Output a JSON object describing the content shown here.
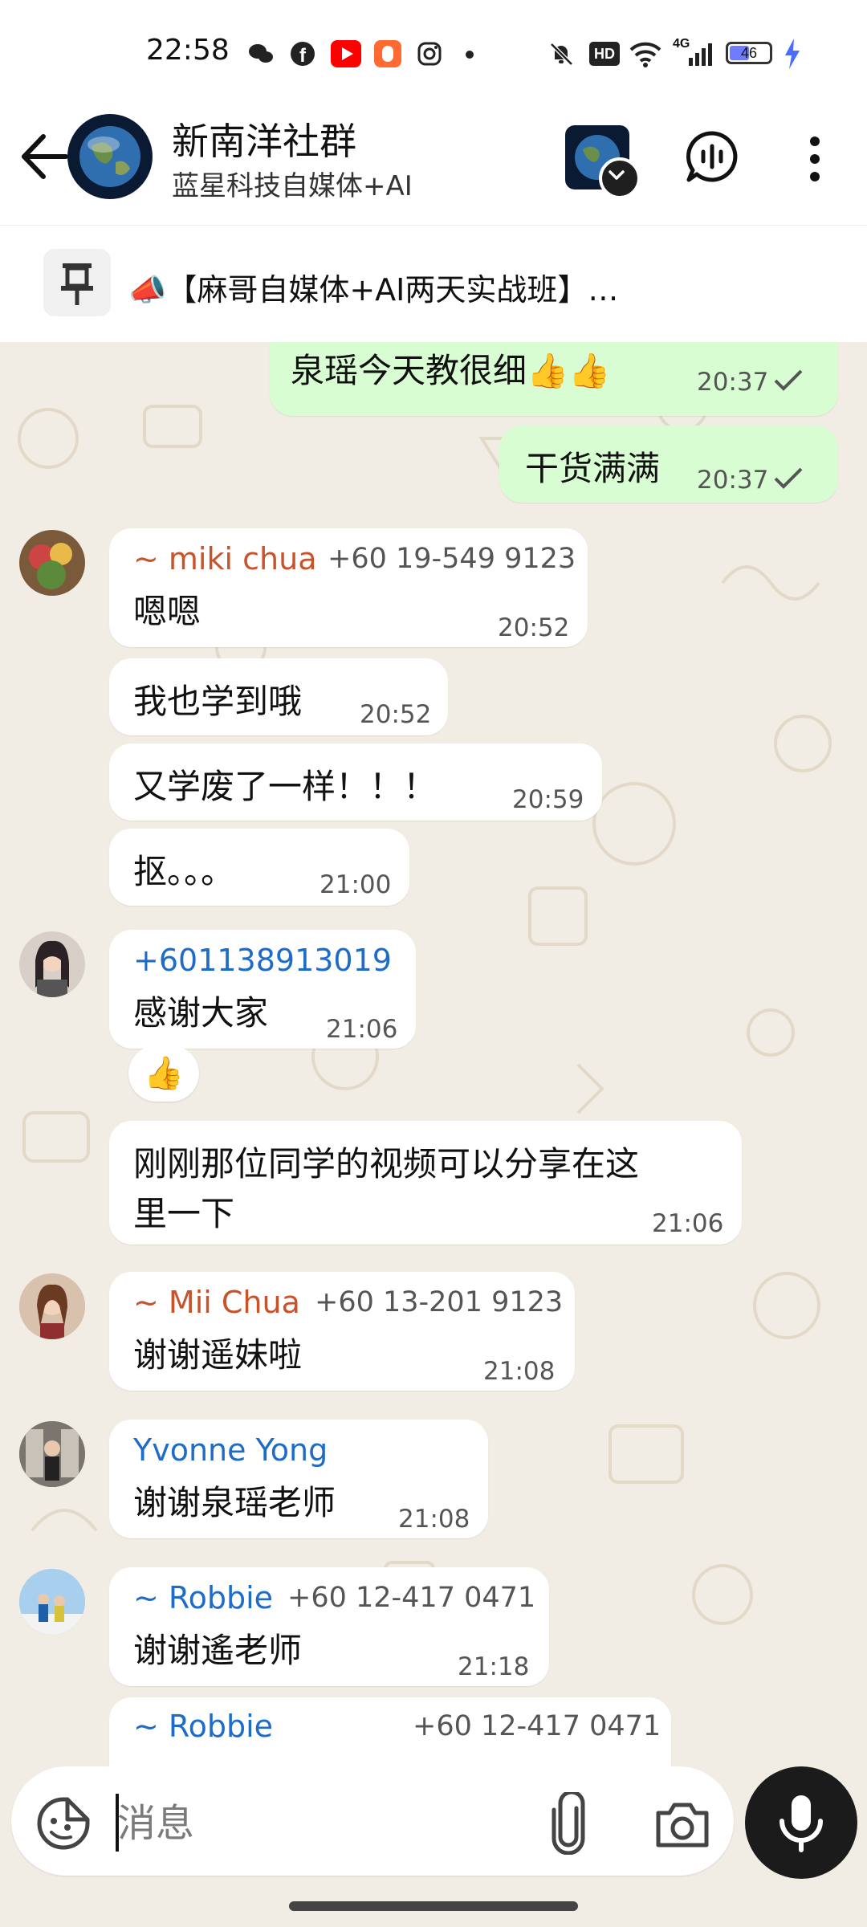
{
  "status_bar": {
    "time": "22:58",
    "hd_label": "HD",
    "net_label": "4G",
    "battery": "46",
    "colors": {
      "youtube": "#ff0000",
      "orange_app": "#ff6a33"
    }
  },
  "header": {
    "title": "新南洋社群",
    "subtitle": "蓝星科技自媒体+AI"
  },
  "pinned": {
    "text": "📣【麻哥自媒体+AI两天实战班】…"
  },
  "messages": [
    {
      "type": "out",
      "text": "泉瑶今天教很细👍👍",
      "time": "20:37"
    },
    {
      "type": "out",
      "text": "干货满满",
      "time": "20:37"
    },
    {
      "type": "in",
      "name": "~ miki chua",
      "phone": "+60 19-549 9123",
      "text": "嗯嗯",
      "time": "20:52"
    },
    {
      "type": "in",
      "text": "我也学到哦",
      "time": "20:52"
    },
    {
      "type": "in",
      "text": "又学废了一样！！！",
      "time": "20:59"
    },
    {
      "type": "in",
      "text": "抠。。。",
      "time": "21:00"
    },
    {
      "type": "in",
      "name": "+601138913019",
      "text": "感谢大家",
      "time": "21:06",
      "reaction": "👍"
    },
    {
      "type": "in",
      "text_line1": "刚刚那位同学的视频可以分享在这",
      "text_line2": "里一下",
      "time": "21:06"
    },
    {
      "type": "in",
      "name": "~ Mii Chua",
      "phone": "+60 13-201 9123",
      "text": "谢谢遥妹啦",
      "time": "21:08"
    },
    {
      "type": "in",
      "name": "Yvonne Yong",
      "text": "谢谢泉瑶老师",
      "time": "21:08"
    },
    {
      "type": "in",
      "name": "~ Robbie",
      "phone": "+60 12-417 0471",
      "text": "谢谢遙老师",
      "time": "21:18"
    },
    {
      "type": "in",
      "name": "~ Robbie",
      "phone": "+60 12-417 0471"
    }
  ],
  "colors": {
    "name_orange": "#c8532b",
    "name_blue": "#1e6cc7",
    "out_bubble": "#d9fdd3"
  },
  "input": {
    "placeholder": "消息"
  }
}
